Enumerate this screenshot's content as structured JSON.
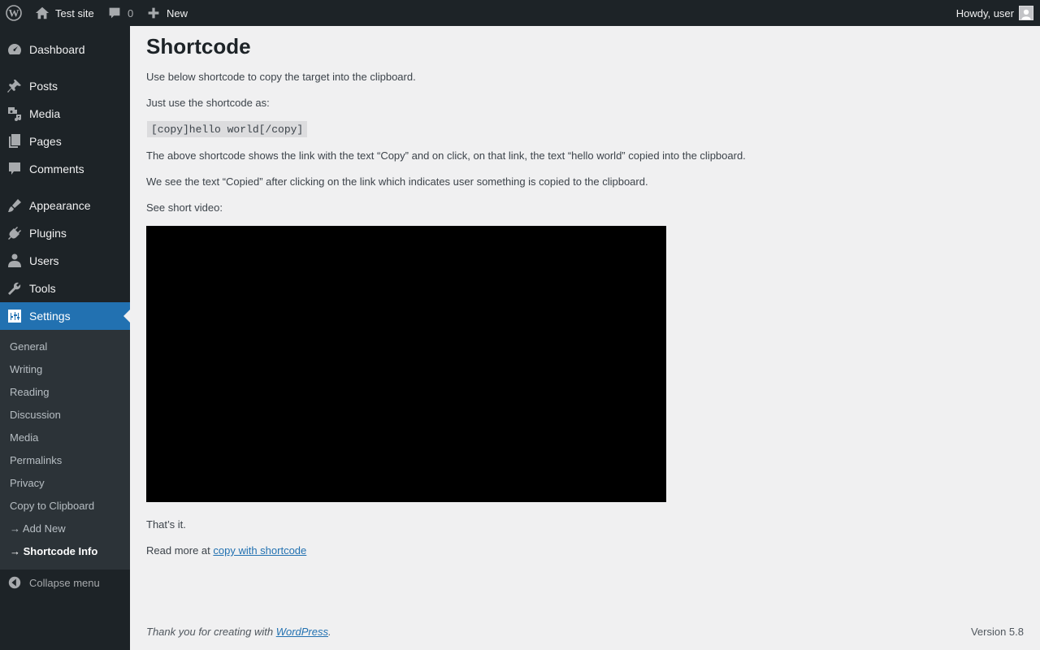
{
  "adminbar": {
    "site_name": "Test site",
    "comments_count": "0",
    "new_label": "New",
    "howdy": "Howdy, user"
  },
  "menu": {
    "items": [
      {
        "label": "Dashboard",
        "icon": "dashboard-icon"
      },
      {
        "label": "Posts",
        "icon": "pin-icon"
      },
      {
        "label": "Media",
        "icon": "media-icon"
      },
      {
        "label": "Pages",
        "icon": "pages-icon"
      },
      {
        "label": "Comments",
        "icon": "comment-icon"
      },
      {
        "label": "Appearance",
        "icon": "brush-icon"
      },
      {
        "label": "Plugins",
        "icon": "plugin-icon"
      },
      {
        "label": "Users",
        "icon": "user-icon"
      },
      {
        "label": "Tools",
        "icon": "wrench-icon"
      },
      {
        "label": "Settings",
        "icon": "settings-icon"
      }
    ],
    "submenu": [
      "General",
      "Writing",
      "Reading",
      "Discussion",
      "Media",
      "Permalinks",
      "Privacy",
      "Copy to Clipboard",
      "→ Add New",
      "→ Shortcode Info"
    ],
    "collapse_label": "Collapse menu"
  },
  "content": {
    "title": "Shortcode",
    "p1": "Use below shortcode to copy the target into the clipboard.",
    "p2": "Just use the shortcode as:",
    "code": "[copy]hello world[/copy]",
    "p3": "The above shortcode shows the link with the text “Copy” and on click, on that link, the text “hello world” copied into the clipboard.",
    "p4": "We see the text “Copied” after clicking on the link which indicates user something is copied to the clipboard.",
    "p5": "See short video:",
    "p6": "That’s it.",
    "p7_prefix": "Read more at ",
    "p7_link": "copy with shortcode"
  },
  "footer": {
    "thanks_prefix": "Thank you for creating with ",
    "thanks_link": "WordPress",
    "thanks_suffix": ".",
    "version": "Version 5.8"
  },
  "colors": {
    "adminbar_bg": "#1d2327",
    "accent": "#2271b1",
    "submenu_bg": "#2c3338",
    "content_bg": "#f0f0f1"
  }
}
